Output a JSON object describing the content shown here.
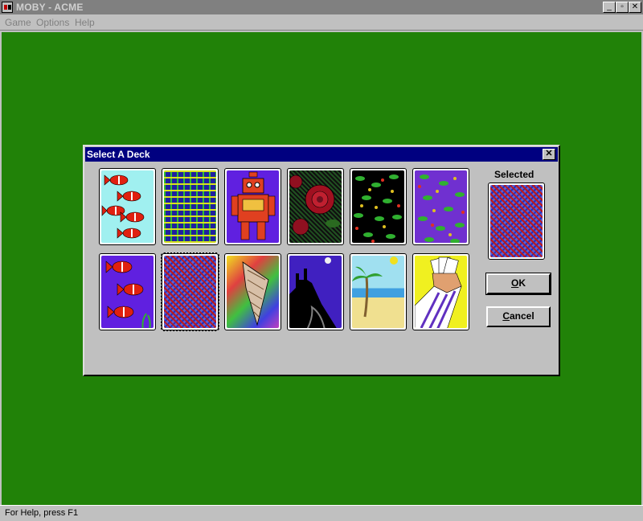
{
  "window": {
    "title": "MOBY - ACME"
  },
  "menu": {
    "game": "Game",
    "options": "Options",
    "help": "Help"
  },
  "status": {
    "text": "For Help, press F1"
  },
  "dialog": {
    "title": "Select A Deck",
    "selected_label": "Selected",
    "ok_pre": "",
    "ok_u": "O",
    "ok_post": "K",
    "cancel_u": "C",
    "cancel_post": "ancel",
    "decks": [
      {
        "name": "fish"
      },
      {
        "name": "weave"
      },
      {
        "name": "robot"
      },
      {
        "name": "roses"
      },
      {
        "name": "vines-black"
      },
      {
        "name": "vines-purple"
      },
      {
        "name": "fish-2"
      },
      {
        "name": "crosshatch"
      },
      {
        "name": "shell"
      },
      {
        "name": "castle"
      },
      {
        "name": "beach"
      },
      {
        "name": "hand"
      }
    ],
    "selected_deck": "crosshatch"
  },
  "colors": {
    "table_green": "#218208",
    "dialog_titlebar": "#000080"
  }
}
